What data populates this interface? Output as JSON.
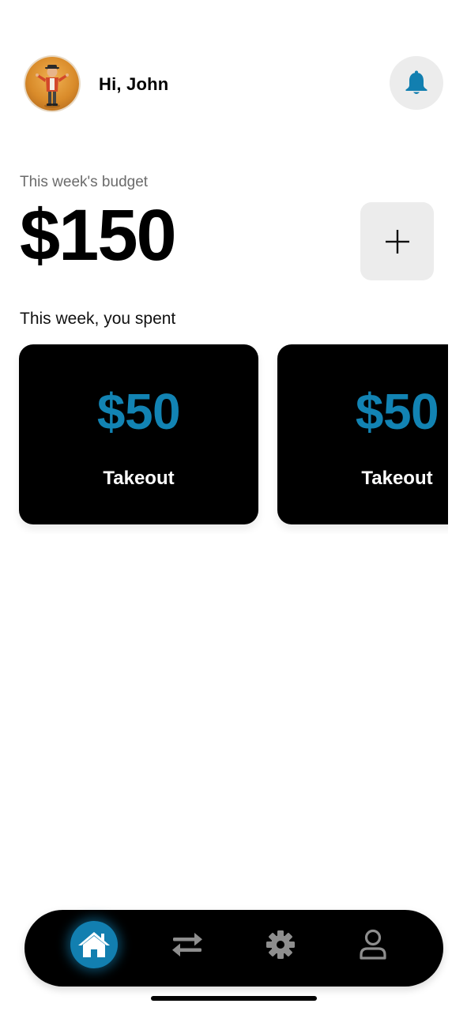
{
  "header": {
    "greeting": "Hi, John",
    "avatar_icon": "user-avatar-illustration",
    "notification_icon": "bell-icon"
  },
  "budget": {
    "label": "This week's budget",
    "amount": "$150",
    "add_icon": "plus-icon"
  },
  "spending": {
    "label": "This week, you spent",
    "cards": [
      {
        "amount": "$50",
        "category": "Takeout"
      },
      {
        "amount": "$50",
        "category": "Takeout"
      }
    ]
  },
  "nav": {
    "items": [
      {
        "icon": "home-icon",
        "active": true
      },
      {
        "icon": "transfer-icon",
        "active": false
      },
      {
        "icon": "gear-icon",
        "active": false
      },
      {
        "icon": "profile-icon",
        "active": false
      }
    ]
  },
  "colors": {
    "accent": "#127fb0",
    "card_background": "#000000",
    "button_background": "#ececec",
    "nav_inactive": "#8e8e8e"
  }
}
